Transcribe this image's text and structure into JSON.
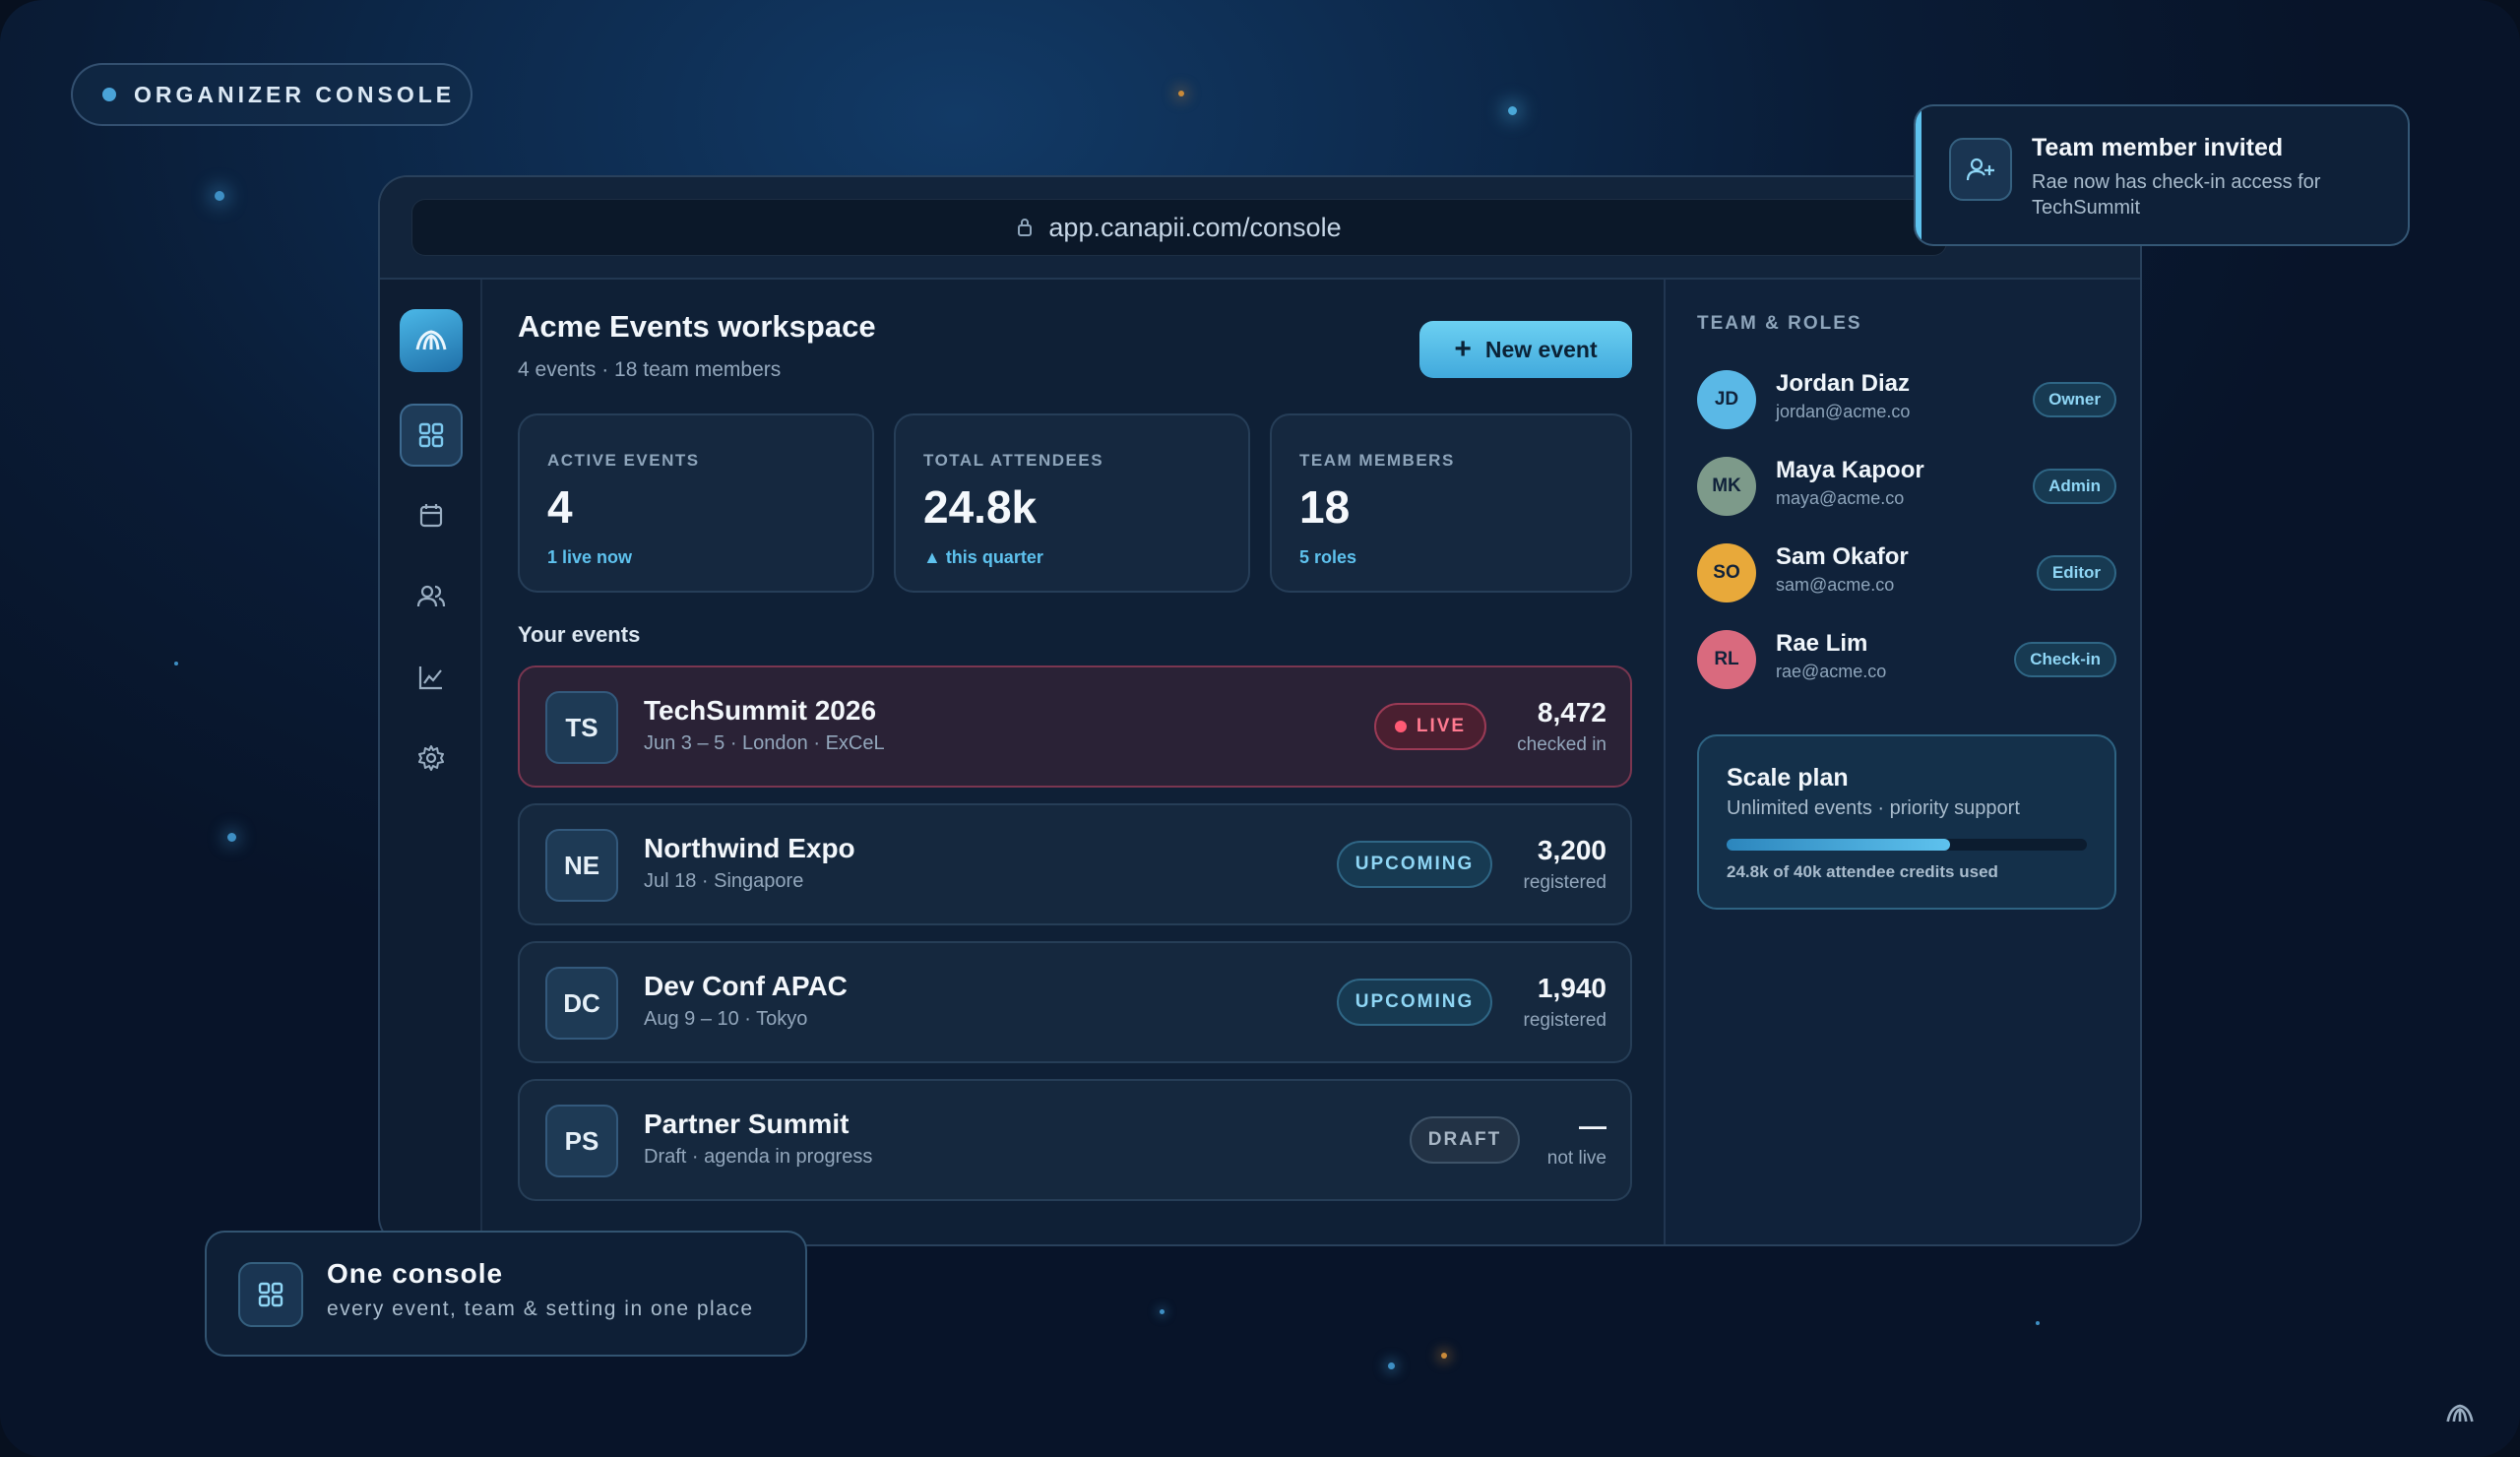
{
  "badge": {
    "label": "ORGANIZER CONSOLE"
  },
  "browser": {
    "url": "app.canapii.com/console"
  },
  "sidebar": {
    "logo_icon": "canapii-logo-icon",
    "items": [
      {
        "icon": "grid-icon",
        "active": true
      },
      {
        "icon": "calendar-icon",
        "active": false
      },
      {
        "icon": "users-icon",
        "active": false
      },
      {
        "icon": "chart-icon",
        "active": false
      },
      {
        "icon": "gear-icon",
        "active": false
      }
    ]
  },
  "workspace": {
    "title": "Acme Events workspace",
    "subtitle": "4 events · 18 team members",
    "new_event_label": "New event"
  },
  "stats": [
    {
      "label": "ACTIVE EVENTS",
      "value": "4",
      "note": "1 live now"
    },
    {
      "label": "TOTAL ATTENDEES",
      "value": "24.8k",
      "note": "▲ this quarter"
    },
    {
      "label": "TEAM MEMBERS",
      "value": "18",
      "note": "5 roles"
    }
  ],
  "events_heading": "Your events",
  "events": [
    {
      "initials": "TS",
      "name": "TechSummit 2026",
      "meta": "Jun 3 – 5 · London · ExCeL",
      "status": "LIVE",
      "count": "8,472",
      "count_label": "checked in"
    },
    {
      "initials": "NE",
      "name": "Northwind Expo",
      "meta": "Jul 18 · Singapore",
      "status": "UPCOMING",
      "count": "3,200",
      "count_label": "registered"
    },
    {
      "initials": "DC",
      "name": "Dev Conf APAC",
      "meta": "Aug 9 – 10 · Tokyo",
      "status": "UPCOMING",
      "count": "1,940",
      "count_label": "registered"
    },
    {
      "initials": "PS",
      "name": "Partner Summit",
      "meta": "Draft · agenda in progress",
      "status": "DRAFT",
      "count": "—",
      "count_label": "not live"
    }
  ],
  "team": {
    "title": "TEAM & ROLES",
    "members": [
      {
        "initials": "JD",
        "name": "Jordan Diaz",
        "email": "jordan@acme.co",
        "role": "Owner",
        "color": "#5ab8e6"
      },
      {
        "initials": "MK",
        "name": "Maya Kapoor",
        "email": "maya@acme.co",
        "role": "Admin",
        "color": "#7d9a8a"
      },
      {
        "initials": "SO",
        "name": "Sam Okafor",
        "email": "sam@acme.co",
        "role": "Editor",
        "color": "#e8a93a"
      },
      {
        "initials": "RL",
        "name": "Rae Lim",
        "email": "rae@acme.co",
        "role": "Check-in",
        "color": "#d96a7e"
      }
    ]
  },
  "plan": {
    "title": "Scale plan",
    "subtitle": "Unlimited events · priority support",
    "usage_fraction": 0.62,
    "usage_label": "24.8k of 40k attendee credits used"
  },
  "toast": {
    "title": "Team member invited",
    "body": "Rae now has check-in access for TechSummit",
    "icon": "user-plus-icon"
  },
  "callout": {
    "title": "One console",
    "subtitle": "every event, team & setting in one place",
    "icon": "grid-icon"
  },
  "colors": {
    "accent": "#5ec2ee",
    "live": "#ff5a74",
    "background": "#0a1c36"
  }
}
